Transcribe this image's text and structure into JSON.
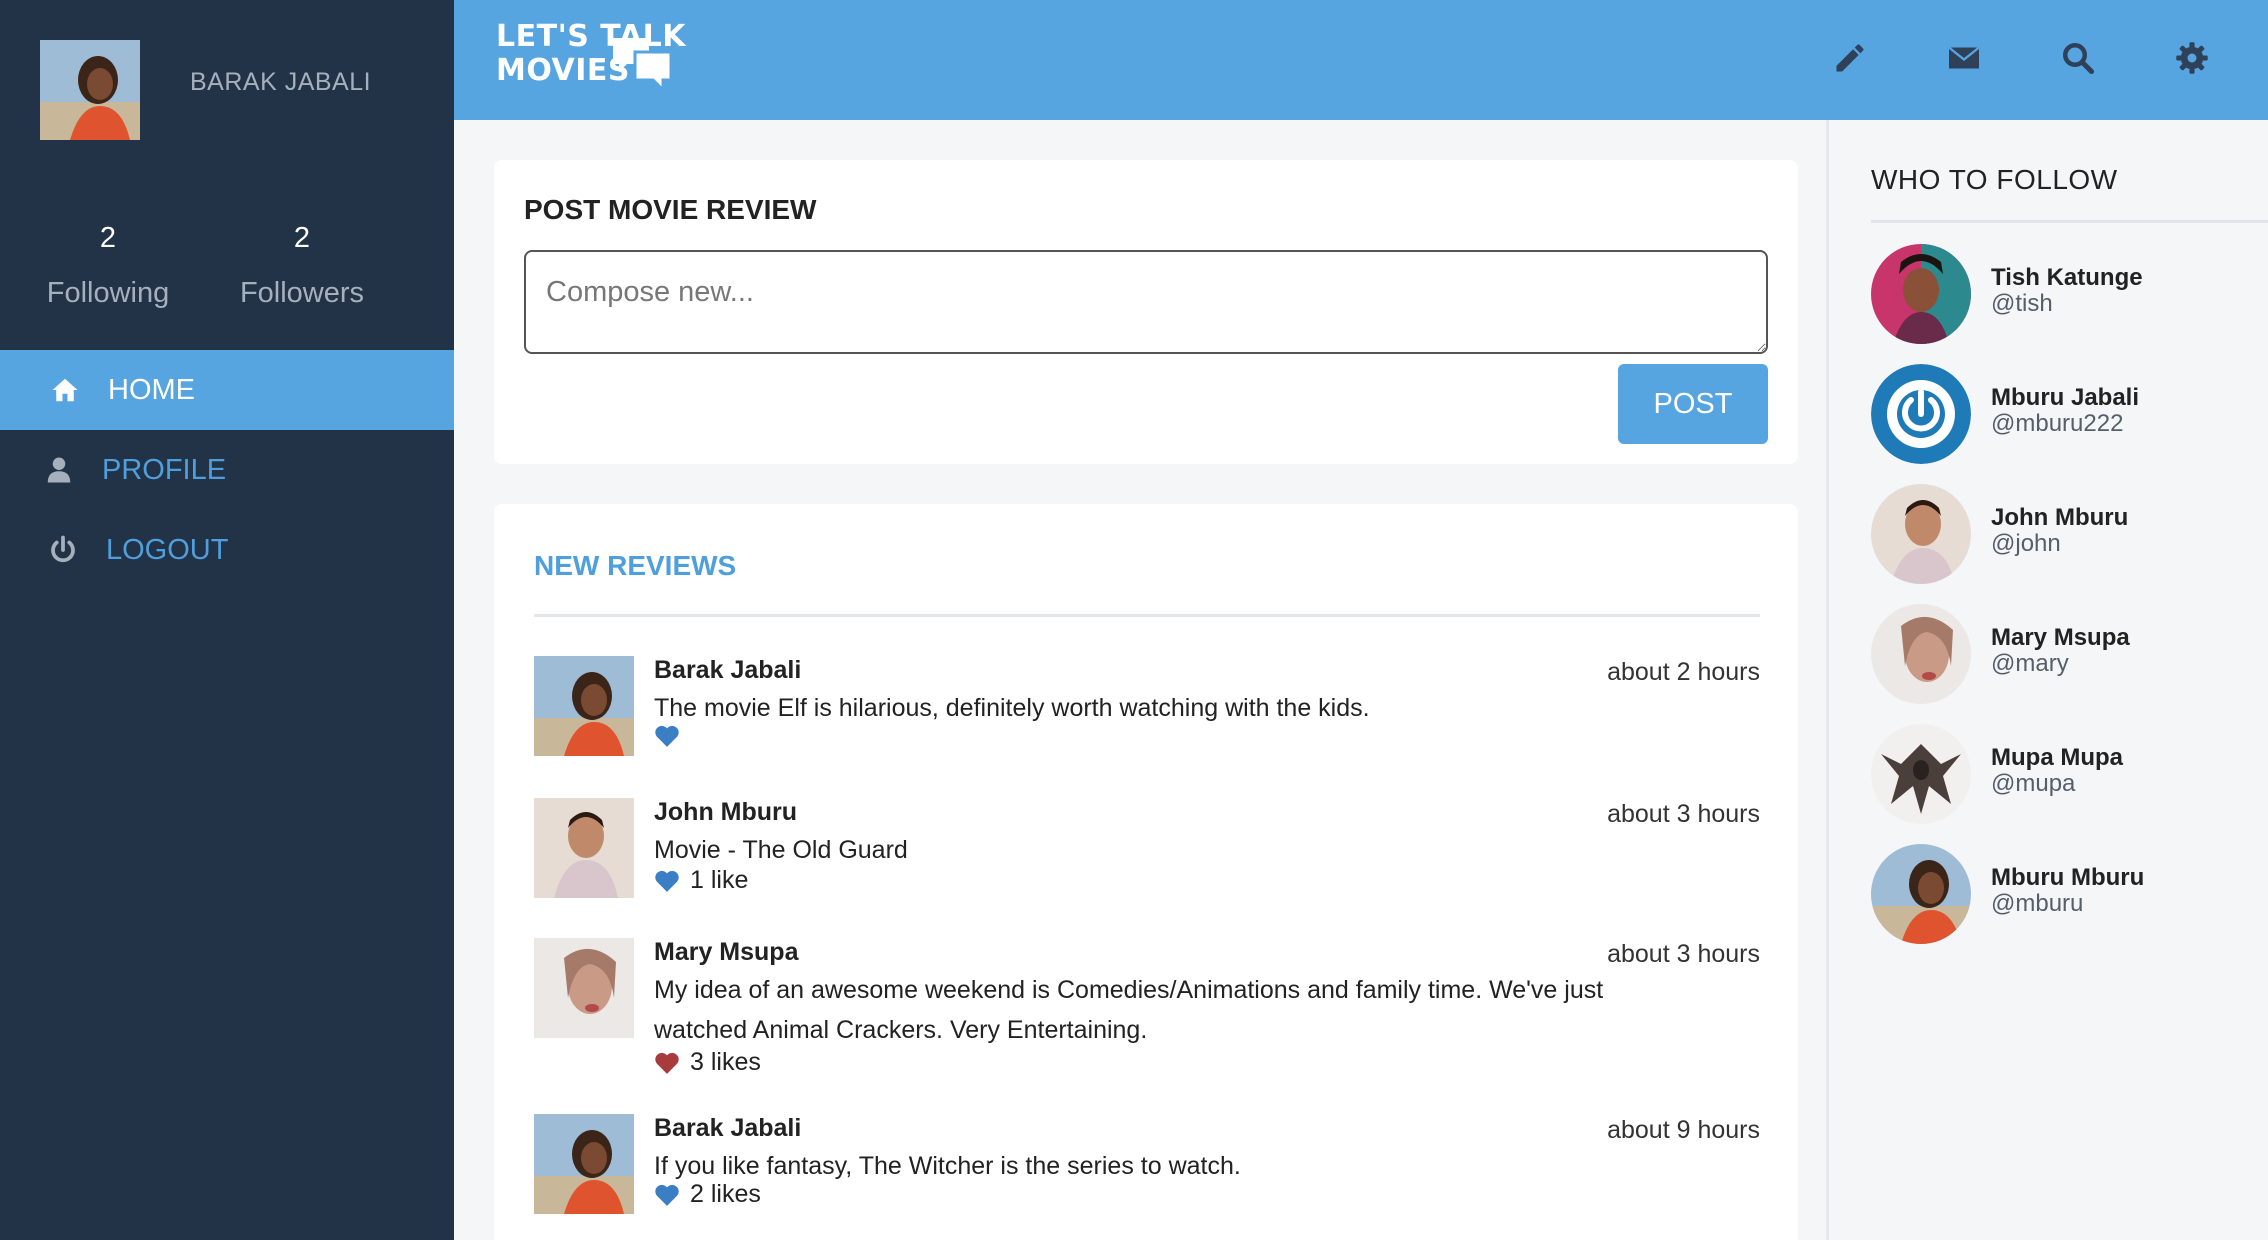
{
  "sidebar": {
    "username": "BARAK JABALI",
    "following_count": "2",
    "following_label": "Following",
    "followers_count": "2",
    "followers_label": "Followers",
    "nav": [
      {
        "label": "HOME",
        "icon": "home-icon"
      },
      {
        "label": "PROFILE",
        "icon": "user-icon"
      },
      {
        "label": "LOGOUT",
        "icon": "power-icon"
      }
    ]
  },
  "header": {
    "logo_line1": "LET'S TALK",
    "logo_line2": "MOVIES",
    "icons": [
      "pencil-icon",
      "envelope-icon",
      "search-icon",
      "gear-icon"
    ]
  },
  "compose": {
    "title": "POST MOVIE REVIEW",
    "placeholder": "Compose new...",
    "post_label": "POST"
  },
  "reviews": {
    "title": "NEW REVIEWS",
    "items": [
      {
        "author": "Barak Jabali",
        "text": "The movie Elf is hilarious, definitely worth watching with the kids.",
        "likes": "",
        "time": "about 2 hours",
        "heart_color": "#3a7fc4"
      },
      {
        "author": "John Mburu",
        "text": "Movie - The Old Guard",
        "likes": "1 like",
        "time": "about 3 hours",
        "heart_color": "#3a7fc4"
      },
      {
        "author": "Mary Msupa",
        "text": "My idea of an awesome weekend is Comedies/Animations and family time. We've just watched Animal Crackers. Very Entertaining.",
        "likes": "3 likes",
        "time": "about 3 hours",
        "heart_color": "#a83b3b"
      },
      {
        "author": "Barak Jabali",
        "text": "If you like fantasy, The Witcher is the series to watch.",
        "likes": "2 likes",
        "time": "about 9 hours",
        "heart_color": "#3a7fc4"
      }
    ]
  },
  "who_to_follow": {
    "title": "WHO TO FOLLOW",
    "people": [
      {
        "name": "Tish Katunge",
        "handle": "@tish"
      },
      {
        "name": "Mburu Jabali",
        "handle": "@mburu222"
      },
      {
        "name": "John Mburu",
        "handle": "@john"
      },
      {
        "name": "Mary Msupa",
        "handle": "@mary"
      },
      {
        "name": "Mupa Mupa",
        "handle": "@mupa"
      },
      {
        "name": "Mburu Mburu",
        "handle": "@mburu"
      }
    ]
  },
  "colors": {
    "accent": "#56a4e0",
    "sidebar_bg": "#223348",
    "link": "#4f9fdd"
  }
}
